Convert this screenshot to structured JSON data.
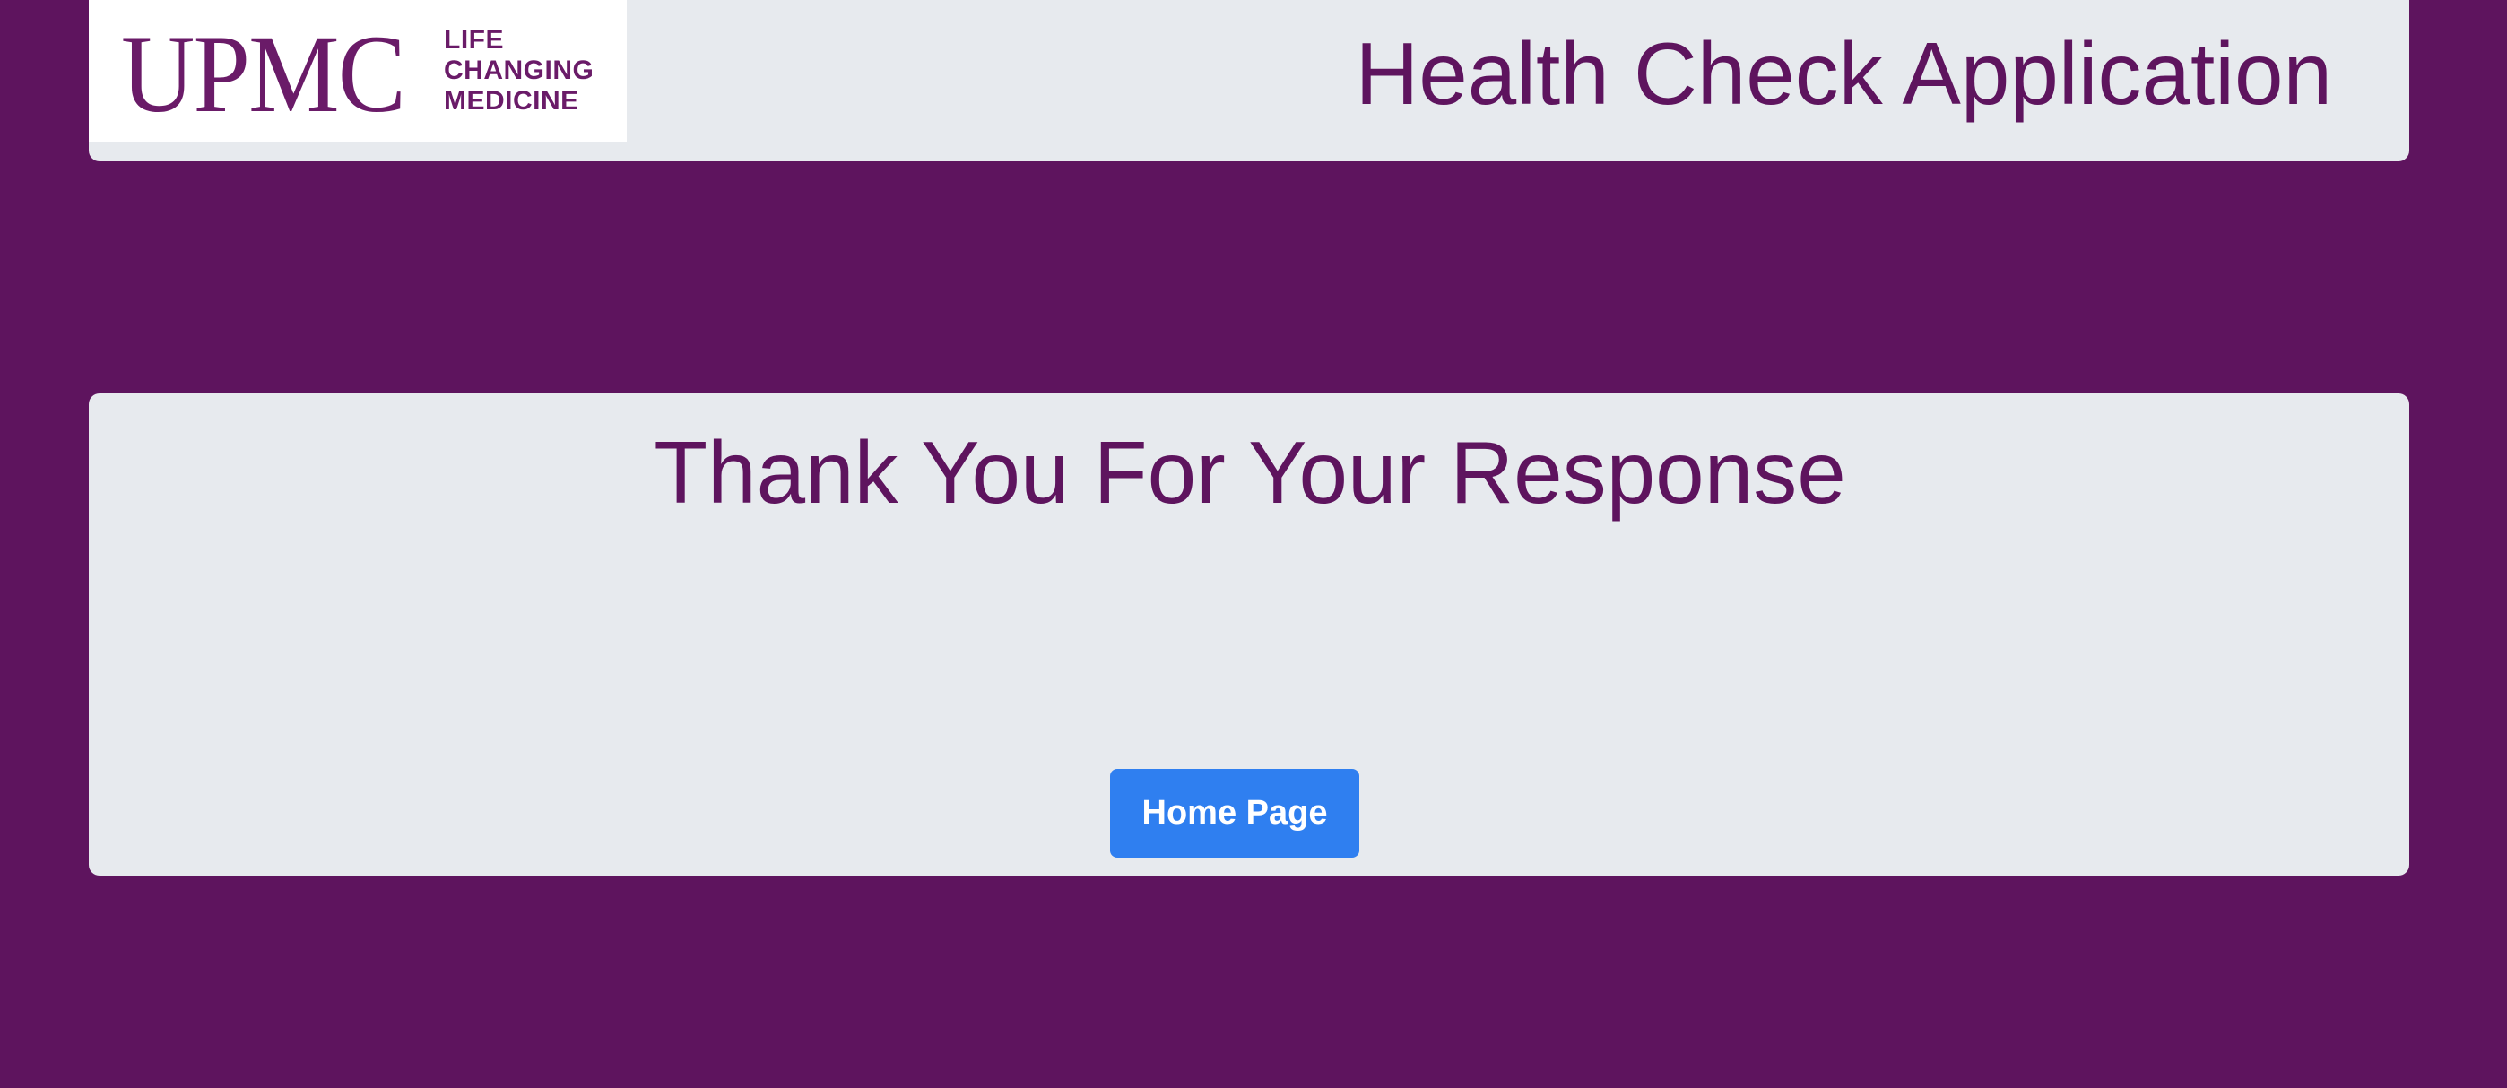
{
  "header": {
    "logo": {
      "wordmark": "UPMC",
      "tagline": [
        "LIFE",
        "CHANGING",
        "MEDICINE"
      ]
    },
    "title": "Health Check Application"
  },
  "main": {
    "heading": "Thank You For Your Response",
    "home_button_label": "Home Page"
  },
  "colors": {
    "page_background": "#5e145e",
    "panel_background": "#e7eaee",
    "brand_purple": "#6a1b68",
    "button_blue": "#2f7ff0"
  }
}
